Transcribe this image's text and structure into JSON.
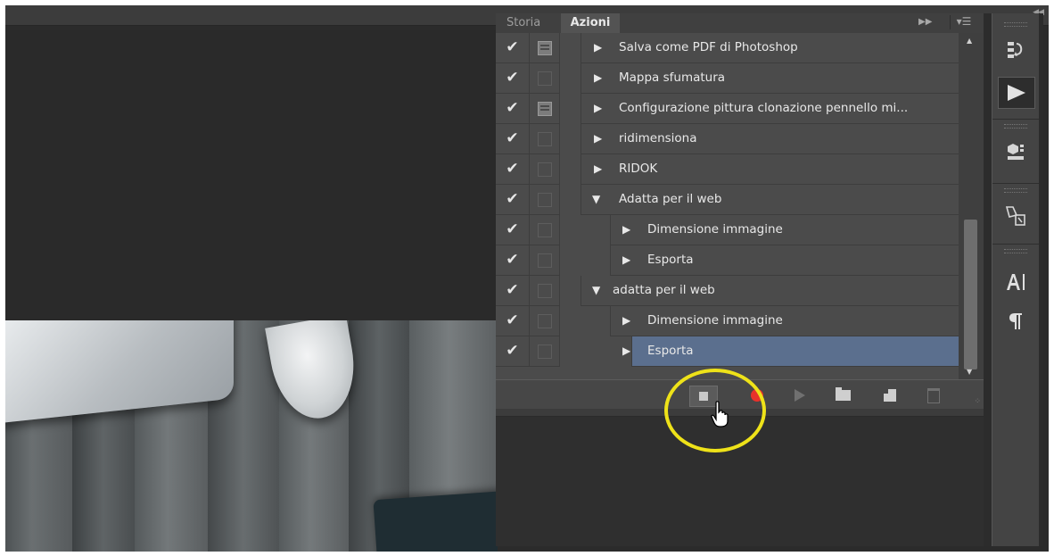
{
  "tabs": {
    "storia": "Storia",
    "azioni": "Azioni"
  },
  "actions": [
    {
      "label": "Salva come PDF di Photoshop",
      "level": 1,
      "expanded": false,
      "dialog": true,
      "checked": true
    },
    {
      "label": "Mappa sfumatura",
      "level": 1,
      "expanded": false,
      "dialog": false,
      "checked": true
    },
    {
      "label": "Configurazione pittura clonazione pennello mi...",
      "level": 1,
      "expanded": false,
      "dialog": true,
      "checked": true
    },
    {
      "label": "ridimensiona",
      "level": 1,
      "expanded": false,
      "dialog": false,
      "checked": true
    },
    {
      "label": "RIDOK",
      "level": 1,
      "expanded": false,
      "dialog": false,
      "checked": true
    },
    {
      "label": "Adatta per il web",
      "level": 1,
      "expanded": true,
      "dialog": false,
      "checked": true
    },
    {
      "label": "Dimensione immagine",
      "level": 2,
      "expanded": false,
      "dialog": false,
      "checked": true
    },
    {
      "label": "Esporta",
      "level": 2,
      "expanded": false,
      "dialog": false,
      "checked": true
    },
    {
      "label": "adatta per il web",
      "level": 1,
      "expanded": true,
      "dialog": false,
      "checked": true
    },
    {
      "label": "Dimensione immagine",
      "level": 2,
      "expanded": false,
      "dialog": false,
      "checked": true
    },
    {
      "label": "Esporta",
      "level": 2,
      "expanded": false,
      "dialog": false,
      "checked": true,
      "selected": true
    }
  ],
  "action_bar": [
    "stop-recording",
    "record",
    "play",
    "new-set",
    "new-action",
    "delete"
  ],
  "colors": {
    "selected_row": "#5b6f8e",
    "record": "#e8322b",
    "highlight": "#eee219",
    "panel": "#4b4b4b"
  },
  "icons": [
    "history-icon",
    "actions-play-icon",
    "properties-icon",
    "brush-presets-icon",
    "character-icon",
    "paragraph-icon"
  ]
}
